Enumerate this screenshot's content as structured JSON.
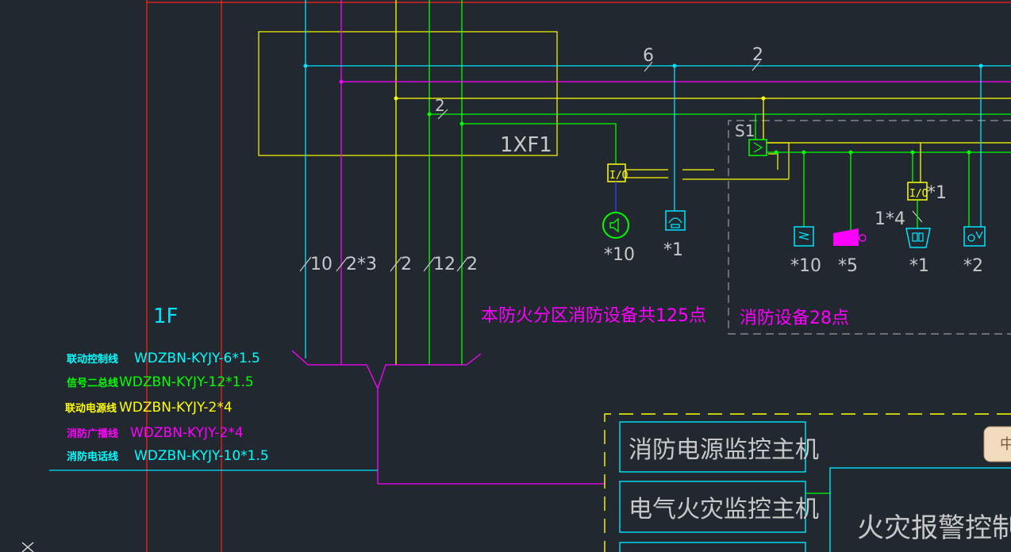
{
  "panel_label": "1XF1",
  "bus_counts": {
    "a": "6",
    "b": "2",
    "c": "2"
  },
  "module": {
    "io": "I/O",
    "s1": "S1",
    "io_right_count": "*1",
    "io_note": "1*4"
  },
  "devices_left": {
    "speaker_count": "*10",
    "phone_count": "*1"
  },
  "devices_right": {
    "detector_count": "*10",
    "call_point_count": "*5",
    "hydrant_count": "*1",
    "valve_count": "*2"
  },
  "cable_marks": [
    "10",
    "2*3",
    "2",
    "12",
    "2"
  ],
  "zone_note": "本防火分区消防设备共125点",
  "subzone_note": "消防设备28点",
  "floor": "1F",
  "legend": [
    {
      "name": "联动控制线",
      "spec": "WDZBN-KYJY-6*1.5",
      "color": "#00ffff"
    },
    {
      "name": "信号二总线",
      "spec": "WDZBN-KYJY-12*1.5",
      "color": "#00ff00"
    },
    {
      "name": "联动电源线",
      "spec": "WDZBN-KYJY-2*4",
      "color": "#ffff00"
    },
    {
      "name": "消防广播线",
      "spec": "WDZBN-KYJY-2*4",
      "color": "#ff00ff"
    },
    {
      "name": "消防电话线",
      "spec": "WDZBN-KYJY-10*1.5",
      "color": "#00ffff"
    }
  ],
  "monitors": {
    "power": "消防电源监控主机",
    "electrical": "电气火灾监控主机",
    "fire_alarm": "火灾报警控制器"
  },
  "tab_glyph": "中",
  "colors": {
    "background": "#212830",
    "red": "#ff2020",
    "cyan": "#00e5ff",
    "magenta": "#ff00ff",
    "yellow": "#ffff00",
    "green": "#00ff00",
    "gray": "#9a9a9a"
  }
}
